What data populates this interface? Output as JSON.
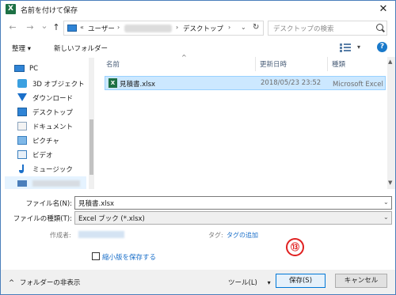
{
  "window": {
    "title": "名前を付けて保存",
    "app_icon": "excel-icon",
    "close_glyph": "✕"
  },
  "navigation": {
    "back_glyph": "←",
    "forward_glyph": "→",
    "recent_glyph": "⌄",
    "up_glyph": "↑",
    "breadcrumb": {
      "chevron_start": "«",
      "user": "ユーザー",
      "sep1": "›",
      "sep2": "›",
      "folder": "デスクトップ",
      "sep3": "›"
    },
    "dropdown_glyph": "⌄",
    "refresh_glyph": "↻",
    "search_placeholder": "デスクトップの検索"
  },
  "toolbar": {
    "organize": "整理 ▾",
    "new_folder": "新しいフォルダー",
    "help": "?",
    "view_drop": "▾"
  },
  "sidebar": {
    "items": [
      {
        "label": "PC",
        "icon": "pc-icon"
      },
      {
        "label": "3D オブジェクト",
        "icon": "3d-objects-icon"
      },
      {
        "label": "ダウンロード",
        "icon": "download-icon"
      },
      {
        "label": "デスクトップ",
        "icon": "desktop-icon"
      },
      {
        "label": "ドキュメント",
        "icon": "documents-icon"
      },
      {
        "label": "ピクチャ",
        "icon": "pictures-icon"
      },
      {
        "label": "ビデオ",
        "icon": "video-icon"
      },
      {
        "label": "ミュージック",
        "icon": "music-icon"
      },
      {
        "label": "",
        "icon": "drive-icon"
      }
    ]
  },
  "filelist": {
    "columns": {
      "name": "名前",
      "modified": "更新日時",
      "type": "種類"
    },
    "sort_glyph": "^",
    "rows": [
      {
        "name": "見積書.xlsx",
        "modified": "2018/05/23 23:52",
        "type": "Microsoft Excel ワ"
      }
    ],
    "scroll_up": "▲",
    "scroll_down": "▼"
  },
  "form": {
    "filename_label": "ファイル名(N):",
    "filename_value": "見積書.xlsx",
    "filetype_label": "ファイルの種類(T):",
    "filetype_value": "Excel ブック (*.xlsx)",
    "drop_glyph": "⌄",
    "author_label": "作成者:",
    "tag_label": "タグ:",
    "tag_link": "タグの追加",
    "thumbnail_label": "縮小版を保存する"
  },
  "callout": {
    "number": "⑬"
  },
  "footer": {
    "hide_folders": "フォルダーの非表示",
    "hide_glyph": "^",
    "tools": "ツール(L)",
    "tools_drop": "▾",
    "save": "保存(S)",
    "cancel": "キャンセル"
  },
  "colors": {
    "accent": "#0078d7",
    "selection": "#cce8ff",
    "callout": "#e02020",
    "link": "#1a6fc9"
  }
}
